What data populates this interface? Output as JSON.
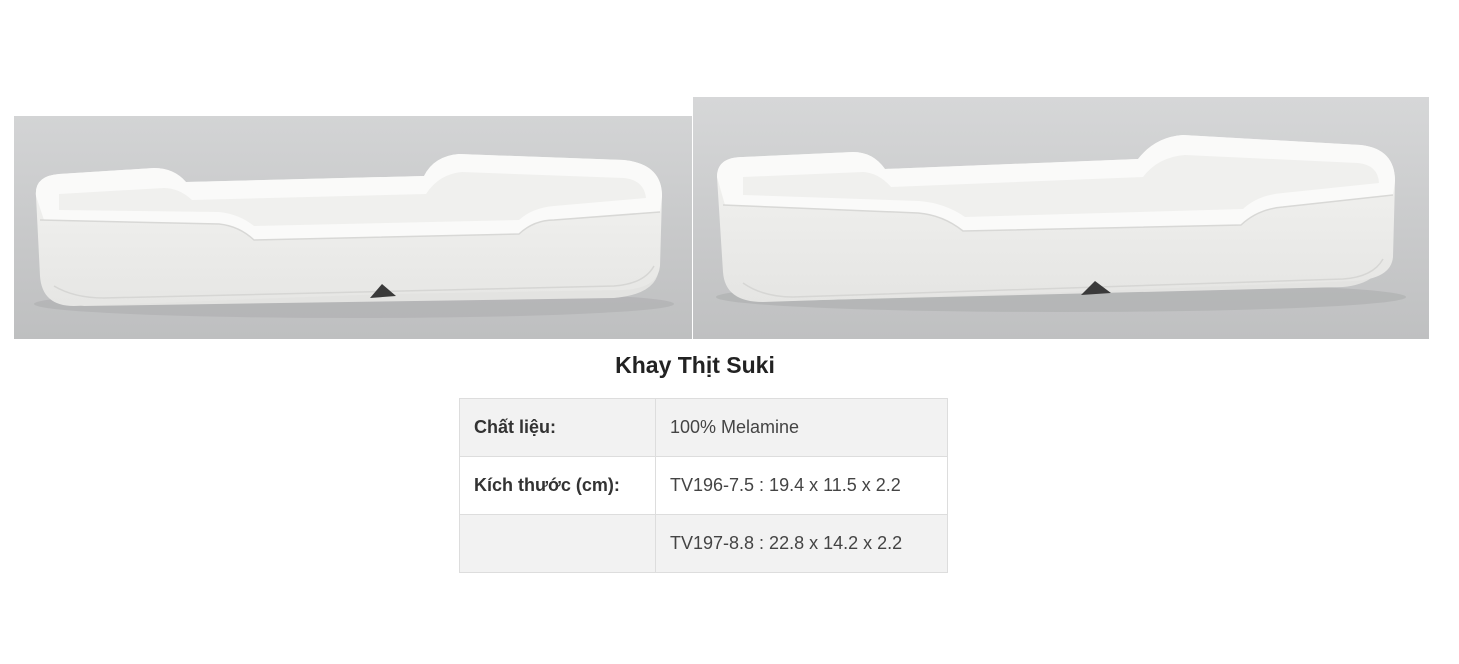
{
  "product": {
    "title": "Khay Thịt Suki",
    "image_1_alt": "Khay Thịt Suki TV196-7.5",
    "image_2_alt": "Khay Thịt Suki TV197-8.8"
  },
  "specs": [
    {
      "label": "Chất liệu:",
      "value": "100% Melamine"
    },
    {
      "label": "Kích thước (cm):",
      "value": "TV196-7.5 : 19.4 x 11.5 x 2.2"
    },
    {
      "label": "",
      "value": "TV197-8.8 : 22.8 x 14.2 x 2.2"
    }
  ],
  "colors": {
    "photo_background": "#c9cacb",
    "tray": "#f5f5f3",
    "table_border": "#dddddd",
    "table_stripe": "#f2f2f2"
  }
}
